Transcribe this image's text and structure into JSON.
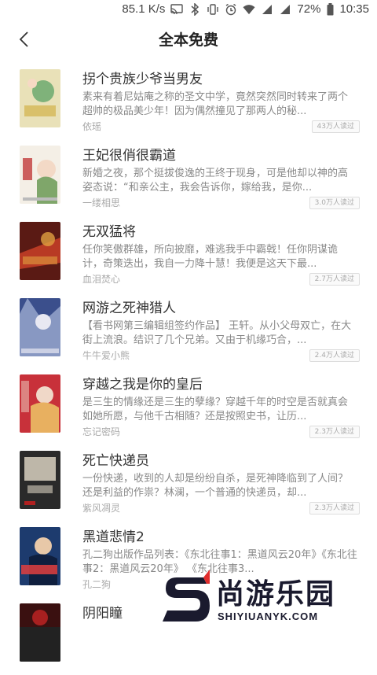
{
  "status_bar": {
    "net_speed": "85.1 K/s",
    "battery": "72%",
    "time": "10:35",
    "icons": [
      "cast-icon",
      "bluetooth-icon",
      "vibrate-icon",
      "alarm-icon",
      "wifi-icon",
      "signal-icon",
      "signal-icon-2",
      "battery-icon"
    ]
  },
  "header": {
    "back_icon": "chevron-left-icon",
    "title": "全本免费"
  },
  "books": [
    {
      "title": "拐个贵族少爷当男友",
      "desc": "素来有着尼姑庵之称的圣文中学，竟然突然同时转来了两个超帅的极品美少年！因为偶然撞见了那两人的秘...",
      "author": "依瑶",
      "reads": "43万人读过",
      "cover_colors": [
        "#e9e1b8",
        "#7fb27a",
        "#d9c06a"
      ]
    },
    {
      "title": "王妃很俏很霸道",
      "desc": "新婚之夜，那个挺拔俊逸的王终于现身，可是他却以神的高姿态说：“和亲公主，我会告诉你，嫁给我，是你...",
      "author": "一缕相思",
      "reads": "3.0万人读过",
      "cover_colors": [
        "#f4efe6",
        "#c23b3b",
        "#7fa66a"
      ]
    },
    {
      "title": "无双猛将",
      "desc": "任你笑傲群雄，所向披靡，难逃我手中霸戟！任你阴谋诡计，奇策迭出，我自一力降十慧！我便是这天下最...",
      "author": "血泪焚心",
      "reads": "2.7万人读过",
      "cover_colors": [
        "#5a1a14",
        "#b83a24",
        "#e0a040"
      ]
    },
    {
      "title": "网游之死神猎人",
      "desc": "【看书网第三编辑组签约作品】 王轩。从小父母双亡，在大街上流浪。结识了几个兄弟。又由于机缘巧合，...",
      "author": "牛牛爱小熊",
      "reads": "2.4万人读过",
      "cover_colors": [
        "#3b4f8c",
        "#a9b8d8",
        "#e8e8f2"
      ]
    },
    {
      "title": "穿越之我是你的皇后",
      "desc": "是三生的情缘还是三生的孽缘？穿越千年的时空是否就真会如她所愿，与他千古相随？还是按照史书，让历...",
      "author": "忘记密码",
      "reads": "2.3万人读过",
      "cover_colors": [
        "#c8313a",
        "#f0d8c8",
        "#e8b060"
      ]
    },
    {
      "title": "死亡快递员",
      "desc": "一份快递，收到的人却是纷纷自杀，是死神降临到了人间？还是利益的作祟？林澜，一个普通的快递员，却...",
      "author": "紫风凋灵",
      "reads": "2.3万人读过",
      "cover_colors": [
        "#2a2a2a",
        "#d8d0c0",
        "#b02020"
      ]
    },
    {
      "title": "黑道悲情2",
      "desc": "孔二狗出版作品列表：《东北往事1：黑道风云20年》《东北往事2：黑道风云20年》 《东北往事3...",
      "author": "孔二狗",
      "reads": "",
      "cover_colors": [
        "#1d3b6e",
        "#e04040",
        "#e8c8a8"
      ]
    },
    {
      "title": "阴阳瞳",
      "desc": "",
      "author": "",
      "reads": "",
      "cover_colors": [
        "#3a1010",
        "#a82020",
        "#222222"
      ]
    }
  ],
  "watermark": {
    "brand": "尚游乐园",
    "url": "SHIYIUANYK.COM"
  }
}
